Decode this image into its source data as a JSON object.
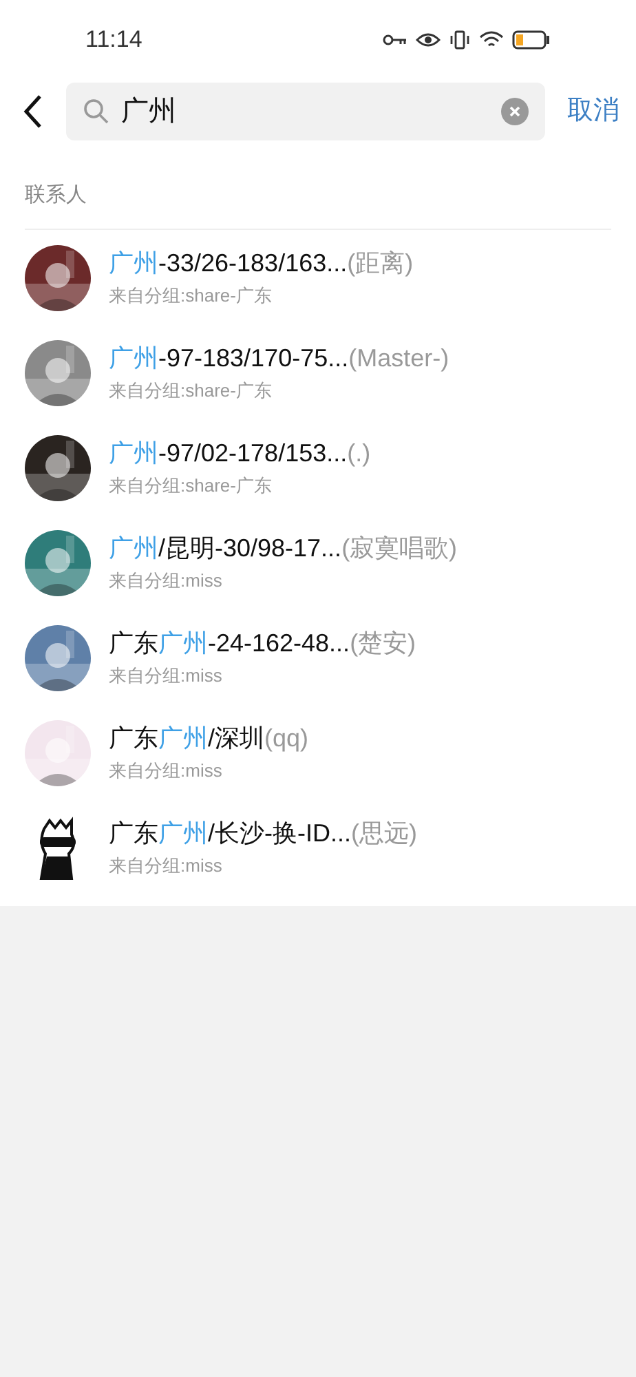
{
  "status_bar": {
    "time": "11:14"
  },
  "search": {
    "query": "广州",
    "cancel": "取消"
  },
  "section_title": "联系人",
  "contacts": [
    {
      "name": [
        {
          "text": "广州",
          "highlighted": true
        },
        {
          "text": "-33/26-183/163...",
          "highlighted": false
        }
      ],
      "remark": "(距离)",
      "source": "来自分组:share-广东",
      "avatar": {
        "kind": "picture",
        "color": "#6b2a2a"
      }
    },
    {
      "name": [
        {
          "text": "广州",
          "highlighted": true
        },
        {
          "text": "-97-183/170-75...",
          "highlighted": false
        }
      ],
      "remark": "(Master-)",
      "source": "来自分组:share-广东",
      "avatar": {
        "kind": "picture",
        "color": "#8a8a8a"
      }
    },
    {
      "name": [
        {
          "text": "广州",
          "highlighted": true
        },
        {
          "text": "-97/02-178/153...",
          "highlighted": false
        }
      ],
      "remark": "(.)",
      "source": "来自分组:share-广东",
      "avatar": {
        "kind": "picture",
        "color": "#2a2420"
      }
    },
    {
      "name": [
        {
          "text": "广州",
          "highlighted": true
        },
        {
          "text": "/昆明-30/98-17...",
          "highlighted": false
        }
      ],
      "remark": "(寂寞唱歌)",
      "source": "来自分组:miss",
      "avatar": {
        "kind": "picture",
        "color": "#2f7d7a"
      }
    },
    {
      "name": [
        {
          "text": "广东",
          "highlighted": false
        },
        {
          "text": "广州",
          "highlighted": true
        },
        {
          "text": "-24-162-48...",
          "highlighted": false
        }
      ],
      "remark": "(楚安)",
      "source": "来自分组:miss",
      "avatar": {
        "kind": "picture",
        "color": "#5f80a8"
      }
    },
    {
      "name": [
        {
          "text": "广东",
          "highlighted": false
        },
        {
          "text": "广州",
          "highlighted": true
        },
        {
          "text": "/深圳",
          "highlighted": false
        }
      ],
      "remark": "(qq)",
      "source": "来自分组:miss",
      "avatar": {
        "kind": "picture",
        "color": "#f3e6ee"
      }
    },
    {
      "name": [
        {
          "text": "广东",
          "highlighted": false
        },
        {
          "text": "广州",
          "highlighted": true
        },
        {
          "text": "/长沙-换-ID...",
          "highlighted": false
        }
      ],
      "remark": "(思远)",
      "source": "来自分组:miss",
      "avatar": {
        "kind": "drawing",
        "color": "#111111"
      }
    }
  ]
}
